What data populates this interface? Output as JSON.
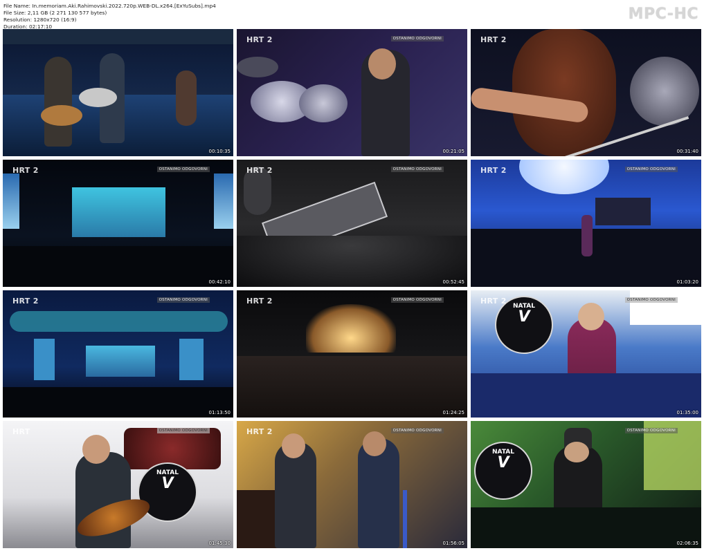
{
  "header": {
    "file_name": "File Name: In.memoriam.Aki.Rahimovski.2022.720p.WEB-DL.x264.[ExYuSubs].mp4",
    "file_size": "File Size: 2,11 GB (2 271 130 577 bytes)",
    "resolution": "Resolution: 1280x720 (16:9)",
    "duration": "Duration: 02:17:10"
  },
  "brand": "MPC-HC",
  "thumbnails": [
    {
      "timecode": "00:10:35",
      "logo": "",
      "watermark": ""
    },
    {
      "timecode": "00:21:05",
      "logo": "HRT 2",
      "watermark": "OSTANIMO ODGOVORNI"
    },
    {
      "timecode": "00:31:40",
      "logo": "HRT 2",
      "watermark": ""
    },
    {
      "timecode": "00:42:10",
      "logo": "HRT 2",
      "watermark": "OSTANIMO ODGOVORNI"
    },
    {
      "timecode": "00:52:45",
      "logo": "HRT 2",
      "watermark": "OSTANIMO ODGOVORNI"
    },
    {
      "timecode": "01:03:20",
      "logo": "HRT 2",
      "watermark": "OSTANIMO ODGOVORNI"
    },
    {
      "timecode": "01:13:50",
      "logo": "HRT 2",
      "watermark": "OSTANIMO ODGOVORNI"
    },
    {
      "timecode": "01:24:25",
      "logo": "HRT 2",
      "watermark": "OSTANIMO ODGOVORNI"
    },
    {
      "timecode": "01:35:00",
      "logo": "HRT 2",
      "watermark": "OSTANIMO ODGOVORNI"
    },
    {
      "timecode": "01:45:30",
      "logo": "HRT",
      "watermark": "OSTANIMO ODGOVORNI"
    },
    {
      "timecode": "01:56:05",
      "logo": "HRT 2",
      "watermark": "OSTANIMO ODGOVORNI"
    },
    {
      "timecode": "02:06:35",
      "logo": "",
      "watermark": "OSTANIMO ODGOVORNI"
    }
  ],
  "drum_logos": {
    "t1": "NATAL",
    "t2": "V"
  },
  "colors": {
    "background": "#ffffff",
    "timecode": "#ffffff",
    "brand": "#d6d6d6",
    "hrt_accent": "#e63a3a"
  }
}
